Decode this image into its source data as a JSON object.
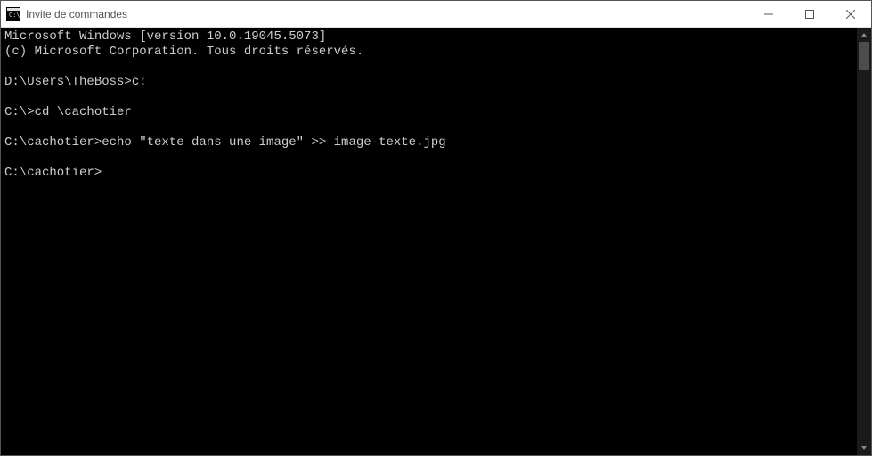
{
  "window": {
    "title": "Invite de commandes"
  },
  "terminal": {
    "lines": [
      "Microsoft Windows [version 10.0.19045.5073]",
      "(c) Microsoft Corporation. Tous droits réservés.",
      "",
      "D:\\Users\\TheBoss>c:",
      "",
      "C:\\>cd \\cachotier",
      "",
      "C:\\cachotier>echo \"texte dans une image\" >> image-texte.jpg",
      "",
      "C:\\cachotier>"
    ]
  }
}
